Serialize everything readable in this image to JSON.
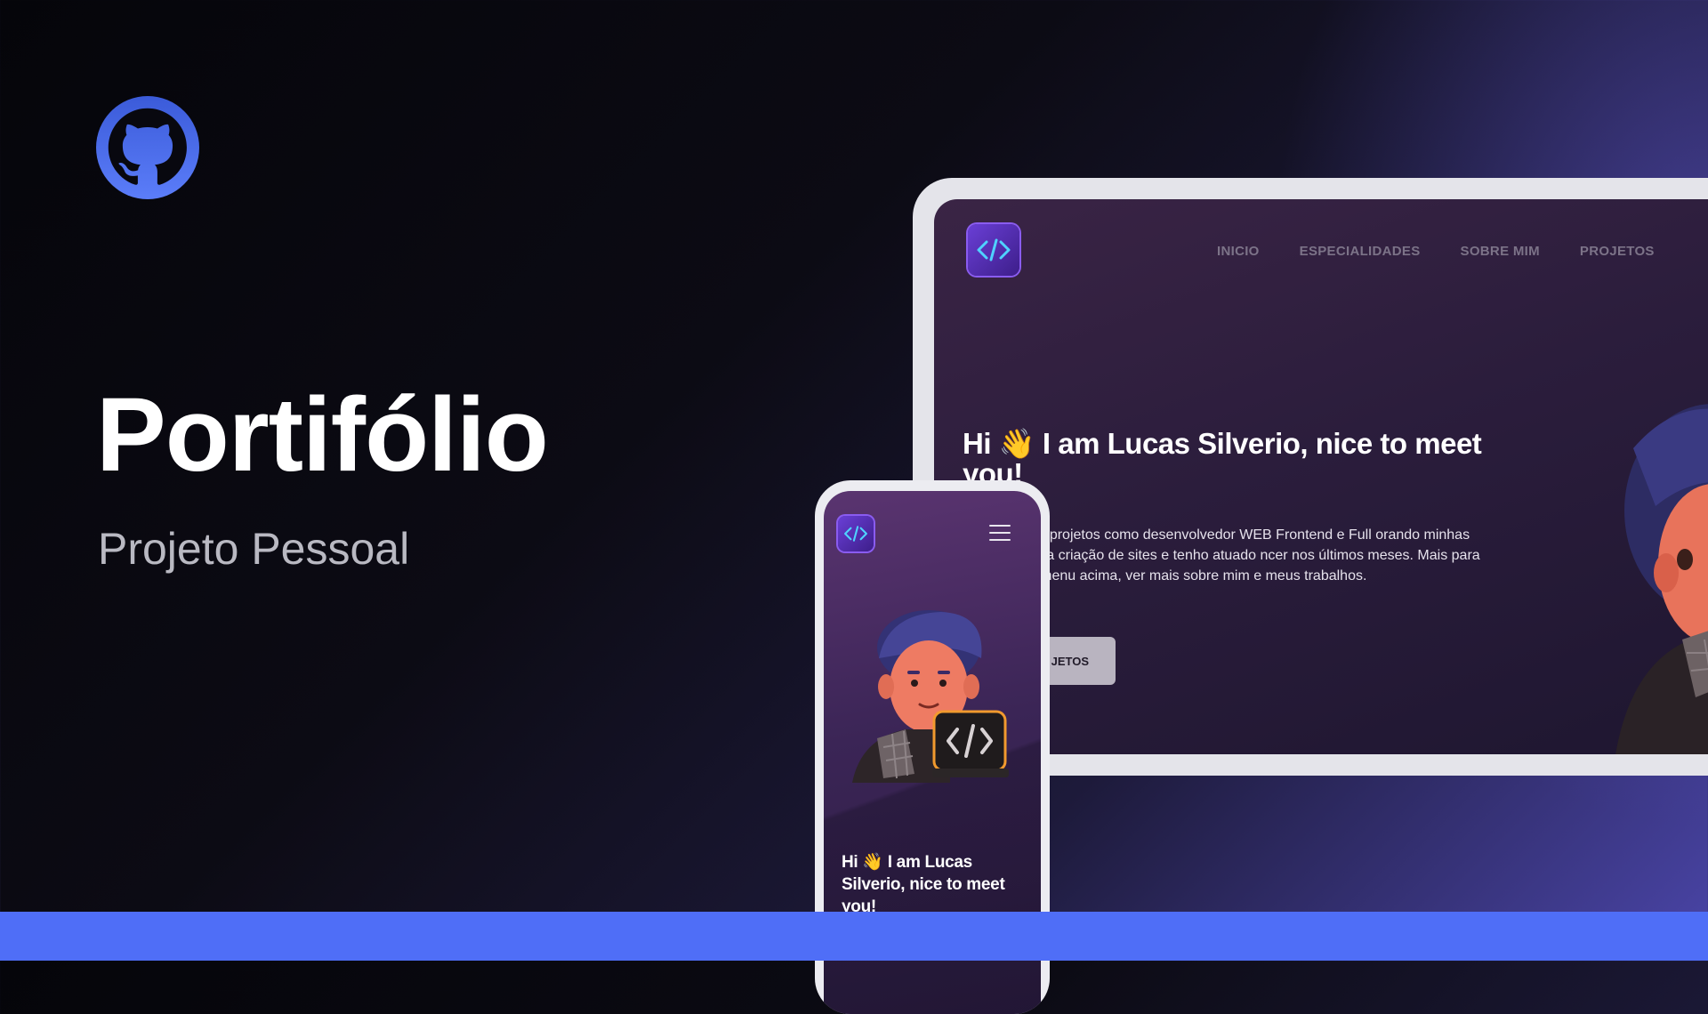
{
  "hero": {
    "title": "Portifólio",
    "subtitle": "Projeto Pessoal"
  },
  "icons": {
    "github": "github-icon",
    "site_logo": "code-brackets-icon",
    "menu": "hamburger-menu-icon",
    "wave": "waving-hand-emoji"
  },
  "tablet": {
    "nav": [
      "INICIO",
      "ESPECIALIDADES",
      "SOBRE MIM",
      "PROJETOS"
    ],
    "heading": "Hi 👋 I am Lucas Silverio, nice to meet you!",
    "paragraph": "os, já realizei projetos como desenvolvedor WEB Frontend e Full orando minhas habilidades na criação de sites e tenho atuado ncer nos últimos meses. Mais para baixo ou no menu acima, ver mais sobre mim e meus trabalhos.",
    "button": "JETOS"
  },
  "phone": {
    "heading": "Hi 👋 I am Lucas Silverio, nice to meet you!"
  },
  "colors": {
    "github_blue": "#4f6ef7",
    "bottom_bar": "#4f6ef7",
    "screen_purple": "#2b1d3c",
    "logo_violet": "#6a3fd6"
  }
}
